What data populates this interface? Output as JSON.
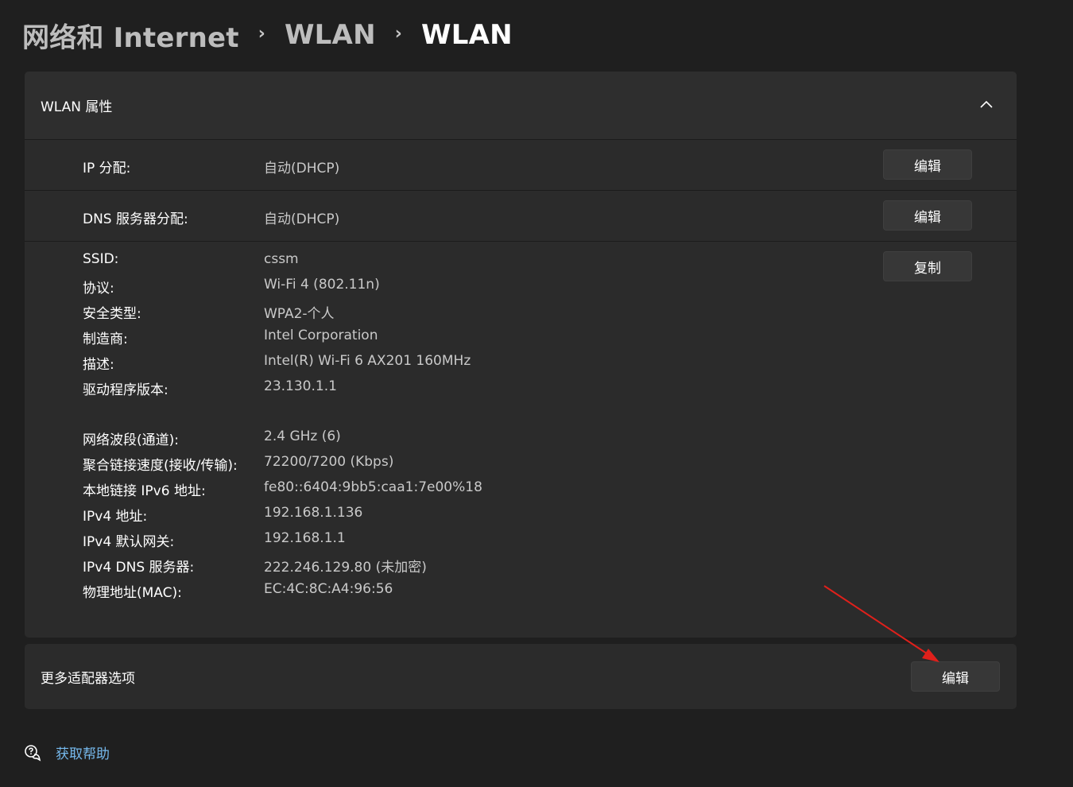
{
  "breadcrumb": {
    "items": [
      "网络和 Internet",
      "WLAN",
      "WLAN"
    ],
    "separator": "›"
  },
  "properties": {
    "title": "WLAN 属性",
    "ip_assignment": {
      "label": "IP 分配:",
      "value": "自动(DHCP)",
      "button": "编辑"
    },
    "dns_assignment": {
      "label": "DNS 服务器分配:",
      "value": "自动(DHCP)",
      "button": "编辑"
    },
    "copy_button": "复制",
    "details_group1": [
      {
        "label": "SSID:",
        "value": "cssm"
      },
      {
        "label": "协议:",
        "value": "Wi-Fi 4 (802.11n)"
      },
      {
        "label": "安全类型:",
        "value": "WPA2-个人"
      },
      {
        "label": "制造商:",
        "value": "Intel Corporation"
      },
      {
        "label": "描述:",
        "value": "Intel(R) Wi-Fi 6 AX201 160MHz"
      },
      {
        "label": "驱动程序版本:",
        "value": "23.130.1.1"
      }
    ],
    "details_group2": [
      {
        "label": "网络波段(通道):",
        "value": "2.4 GHz (6)"
      },
      {
        "label": "聚合链接速度(接收/传输):",
        "value": "72200/7200 (Kbps)"
      },
      {
        "label": "本地链接 IPv6 地址:",
        "value": "fe80::6404:9bb5:caa1:7e00%18"
      },
      {
        "label": "IPv4 地址:",
        "value": "192.168.1.136"
      },
      {
        "label": "IPv4 默认网关:",
        "value": "192.168.1.1"
      },
      {
        "label": "IPv4 DNS 服务器:",
        "value": "222.246.129.80 (未加密)"
      },
      {
        "label": "物理地址(MAC):",
        "value": "EC:4C:8C:A4:96:56"
      }
    ]
  },
  "more_options": {
    "title": "更多适配器选项",
    "button": "编辑"
  },
  "help": {
    "label": "获取帮助",
    "icon": "help-chat-icon"
  },
  "colors": {
    "background": "#1f1f1f",
    "card": "#2b2b2b",
    "link": "#76b9ed",
    "annotation_arrow": "#e0201b"
  }
}
